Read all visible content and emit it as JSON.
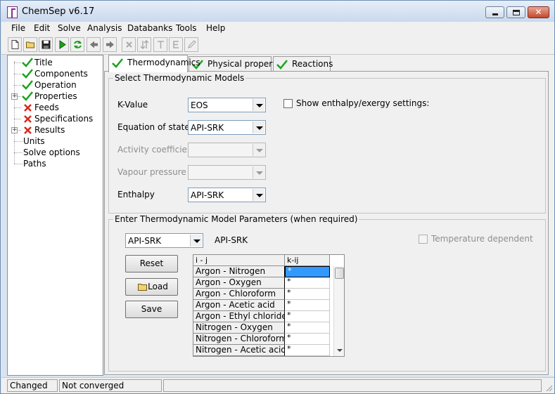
{
  "window": {
    "title": "ChemSep v6.17"
  },
  "menu": [
    "File",
    "Edit",
    "Solve",
    "Analysis",
    "Databanks",
    "Tools",
    "Help"
  ],
  "toolbar": {
    "buttons": [
      "new-file-icon",
      "open-folder-icon",
      "save-icon",
      "run-icon",
      "refresh-icon",
      "back-icon",
      "forward-icon",
      "delete-icon",
      "swap-icon",
      "text-icon",
      "edit-icon",
      "pencil-icon"
    ]
  },
  "tree": {
    "items": [
      {
        "label": "Title",
        "status": "ok"
      },
      {
        "label": "Components",
        "status": "ok"
      },
      {
        "label": "Operation",
        "status": "ok"
      },
      {
        "label": "Properties",
        "status": "ok"
      },
      {
        "label": "Feeds",
        "status": "error"
      },
      {
        "label": "Specifications",
        "status": "error"
      },
      {
        "label": "Results",
        "status": "error"
      },
      {
        "label": "Units",
        "status": "none"
      },
      {
        "label": "Solve options",
        "status": "none"
      },
      {
        "label": "Paths",
        "status": "none"
      }
    ]
  },
  "tabs": [
    {
      "label": "Thermodynamics"
    },
    {
      "label": "Physical properties"
    },
    {
      "label": "Reactions"
    }
  ],
  "models": {
    "group_title": "Select Thermodynamic Models",
    "kvalue": {
      "label": "K-Value",
      "value": "EOS"
    },
    "eos": {
      "label": "Equation of state",
      "value": "API-SRK"
    },
    "activity": {
      "label": "Activity coefficient",
      "value": ""
    },
    "vapour": {
      "label": "Vapour pressure",
      "value": ""
    },
    "enthalpy": {
      "label": "Enthalpy",
      "value": "API-SRK"
    },
    "show_enthalpy_label": "Show enthalpy/exergy settings:"
  },
  "params": {
    "group_title": "Enter Thermodynamic Model Parameters (when required)",
    "model_select": "API-SRK",
    "model_name": "API-SRK",
    "temperature_dependent_label": "Temperature dependent",
    "reset_label": "Reset",
    "load_label": "Load",
    "save_label": "Save",
    "grid": {
      "col_pair": "i - j",
      "col_kij": "k-ij",
      "rows": [
        {
          "pair": "Argon - Nitrogen",
          "kij": "*"
        },
        {
          "pair": "Argon - Oxygen",
          "kij": "*"
        },
        {
          "pair": "Argon - Chloroform",
          "kij": "*"
        },
        {
          "pair": "Argon - Acetic acid",
          "kij": "*"
        },
        {
          "pair": "Argon - Ethyl chloride",
          "kij": "*"
        },
        {
          "pair": "Nitrogen - Oxygen",
          "kij": "*"
        },
        {
          "pair": "Nitrogen - Chloroform",
          "kij": "*"
        },
        {
          "pair": "Nitrogen - Acetic acid",
          "kij": "*"
        }
      ]
    }
  },
  "status": {
    "left": "Changed",
    "middle": "Not converged"
  }
}
